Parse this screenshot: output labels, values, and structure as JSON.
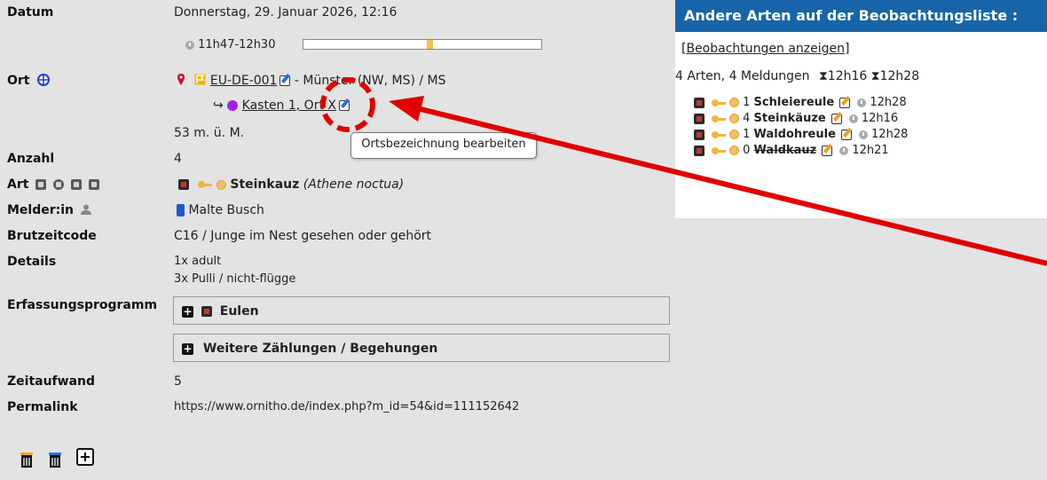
{
  "labels": {
    "datum": "Datum",
    "ort": "Ort",
    "anzahl": "Anzahl",
    "art": "Art",
    "melder": "Melder:in",
    "brutzeitcode": "Brutzeitcode",
    "details": "Details",
    "erfassungsprogramm": "Erfassungsprogramm",
    "zeitaufwand": "Zeitaufwand",
    "permalink": "Permalink"
  },
  "values": {
    "datum": "Donnerstag, 29. Januar 2026, 12:16",
    "time_range": "11h47-12h30",
    "time_progress": 0.53,
    "site_code": "EU-DE-001",
    "site_rest": " - Münster (NW, MS) / MS",
    "sub_location": "Kasten 1, Ort X",
    "altitude": "53 m. ü. M.",
    "anzahl": "4",
    "species_common": "Steinkauz",
    "species_latin": "(Athene noctua)",
    "observer": "Malte Busch",
    "brutzeitcode": "C16 / Junge im Nest gesehen oder gehört",
    "details_line1": "1x adult",
    "details_line2": "3x Pulli / nicht-flügge",
    "programm_eulen": "Eulen",
    "programm_weitere": "Weitere Zählungen / Begehungen",
    "zeitaufwand": "5",
    "permalink": "https://www.ornitho.de/index.php?m_id=54&id=111152642"
  },
  "tooltip": "Ortsbezeichnung bearbeiten",
  "panel": {
    "title": "Andere Arten auf der Beobachtungsliste :",
    "link": "[Beobachtungen anzeigen]",
    "summary": "4 Arten, 4 Meldungen",
    "time_first": "12h16",
    "time_last": "12h28",
    "items": [
      {
        "count": "1",
        "name": "Schleiereule",
        "time": "12h28",
        "struck": false
      },
      {
        "count": "4",
        "name": "Steinkäuze",
        "time": "12h16",
        "struck": false
      },
      {
        "count": "1",
        "name": "Waldohreule",
        "time": "12h28",
        "struck": false
      },
      {
        "count": "0",
        "name": "Waldkauz",
        "time": "12h21",
        "struck": true
      }
    ]
  },
  "colors": {
    "background": "#e3e3e3",
    "panel_header": "#1764a8",
    "annotation_red": "#e00000",
    "progress_marker": "#f5c04a"
  },
  "icons": [
    "calendar-clock-icon",
    "globe-icon",
    "map-pin-icon",
    "flag-icon",
    "edit-icon",
    "purple-circle-icon",
    "list-icon",
    "grid-icon",
    "chart-icon",
    "info-icon",
    "user-icon",
    "mobile-phone-icon",
    "plus-box-icon",
    "trash-icon",
    "add-icon"
  ]
}
